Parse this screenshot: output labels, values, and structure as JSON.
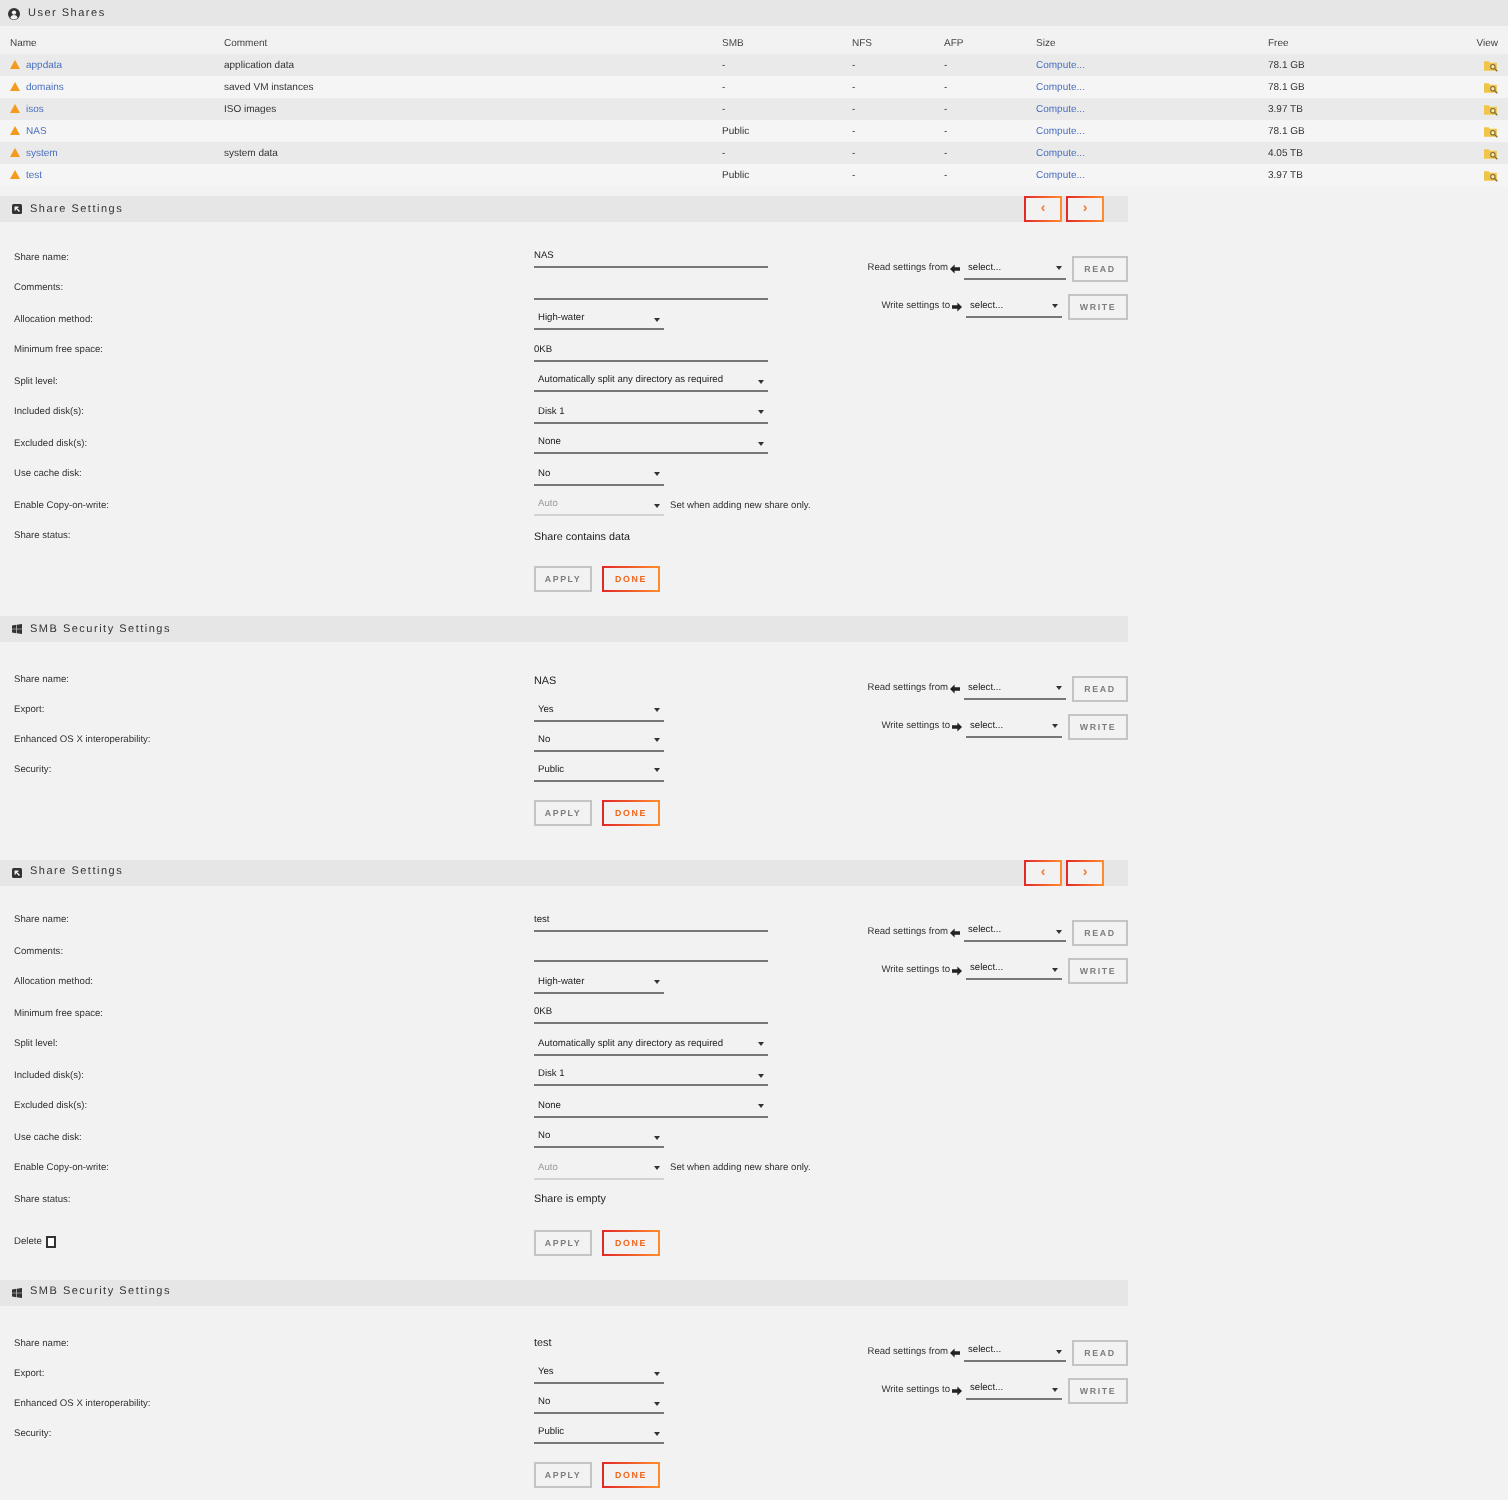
{
  "user_shares": {
    "title": "User Shares",
    "columns": [
      "Name",
      "Comment",
      "SMB",
      "NFS",
      "AFP",
      "Size",
      "Free",
      "View"
    ],
    "rows": [
      {
        "name": "appdata",
        "comment": "application data",
        "smb": "-",
        "nfs": "-",
        "afp": "-",
        "size": "Compute...",
        "free": "78.1 GB"
      },
      {
        "name": "domains",
        "comment": "saved VM instances",
        "smb": "-",
        "nfs": "-",
        "afp": "-",
        "size": "Compute...",
        "free": "78.1 GB"
      },
      {
        "name": "isos",
        "comment": "ISO images",
        "smb": "-",
        "nfs": "-",
        "afp": "-",
        "size": "Compute...",
        "free": "3.97 TB"
      },
      {
        "name": "NAS",
        "smb": "Public",
        "nfs": "-",
        "afp": "-",
        "size": "Compute...",
        "free": "78.1 GB"
      },
      {
        "name": "system",
        "comment": "system data",
        "smb": "-",
        "nfs": "-",
        "afp": "-",
        "size": "Compute...",
        "free": "4.05 TB"
      },
      {
        "name": "test",
        "smb": "Public",
        "nfs": "-",
        "afp": "-",
        "size": "Compute...",
        "free": "3.97 TB"
      }
    ]
  },
  "sections": [
    {
      "kind": "share",
      "title": "Share Settings",
      "nav_buttons": [
        "‹",
        "›"
      ],
      "fields": [
        {
          "kind": "input",
          "label": "Share name:",
          "value": "NAS",
          "disabled": false
        },
        {
          "kind": "input",
          "label": "Comments:",
          "disabled": false
        },
        {
          "kind": "select",
          "label": "Allocation method:",
          "value": "High-water",
          "disabled": false
        },
        {
          "kind": "input",
          "label": "Minimum free space:",
          "value": "0KB",
          "disabled": false
        },
        {
          "kind": "wideselect",
          "label": "Split level:",
          "value": "Automatically split any directory as required",
          "disabled": false
        },
        {
          "kind": "wideselect",
          "label": "Included disk(s):",
          "value": "Disk 1",
          "disabled": false
        },
        {
          "kind": "wideselect",
          "label": "Excluded disk(s):",
          "value": "None",
          "disabled": false
        },
        {
          "kind": "select",
          "label": "Use cache disk:",
          "value": "No",
          "disabled": false
        },
        {
          "kind": "select",
          "label": "Enable Copy-on-write:",
          "value": "Auto",
          "disabled": true,
          "note": "Set when adding new share only."
        },
        {
          "kind": "static",
          "label": "Share status:",
          "value": "Share contains data",
          "disabled": false
        }
      ],
      "read": {
        "label": "Read settings from",
        "value": "select...",
        "button": "READ",
        "disabled": true
      },
      "write": {
        "label": "Write settings to",
        "value": "select...",
        "button": "WRITE",
        "disabled": true
      },
      "buttons": [
        {
          "label": "APPLY",
          "disabled": true
        },
        {
          "label": "DONE",
          "disabled": false
        }
      ]
    },
    {
      "kind": "smb",
      "title": "SMB Security Settings",
      "fields": [
        {
          "kind": "static",
          "label": "Share name:",
          "value": "NAS",
          "disabled": false
        },
        {
          "kind": "select",
          "label": "Export:",
          "value": "Yes",
          "disabled": false
        },
        {
          "kind": "select",
          "label": "Enhanced OS X interoperability:",
          "value": "No",
          "disabled": false
        },
        {
          "kind": "select",
          "label": "Security:",
          "value": "Public",
          "disabled": false
        }
      ],
      "read": {
        "label": "Read settings from",
        "value": "select...",
        "button": "READ",
        "disabled": true
      },
      "write": {
        "label": "Write settings to",
        "value": "select...",
        "button": "WRITE",
        "disabled": true
      },
      "buttons": [
        {
          "label": "APPLY",
          "disabled": true
        },
        {
          "label": "DONE",
          "disabled": false
        }
      ]
    },
    {
      "kind": "share",
      "title": "Share Settings",
      "nav_buttons": [
        "‹",
        "›"
      ],
      "fields": [
        {
          "kind": "input",
          "label": "Share name:",
          "value": "test",
          "disabled": false
        },
        {
          "kind": "input",
          "label": "Comments:",
          "disabled": false
        },
        {
          "kind": "select",
          "label": "Allocation method:",
          "value": "High-water",
          "disabled": false
        },
        {
          "kind": "input",
          "label": "Minimum free space:",
          "value": "0KB",
          "disabled": false
        },
        {
          "kind": "wideselect",
          "label": "Split level:",
          "value": "Automatically split any directory as required",
          "disabled": false
        },
        {
          "kind": "wideselect",
          "label": "Included disk(s):",
          "value": "Disk 1",
          "disabled": false
        },
        {
          "kind": "wideselect",
          "label": "Excluded disk(s):",
          "value": "None",
          "disabled": false
        },
        {
          "kind": "select",
          "label": "Use cache disk:",
          "value": "No",
          "disabled": false
        },
        {
          "kind": "select",
          "label": "Enable Copy-on-write:",
          "value": "Auto",
          "disabled": true,
          "note": "Set when adding new share only."
        },
        {
          "kind": "static",
          "label": "Share status:",
          "value": "Share is empty",
          "disabled": false
        }
      ],
      "delete": {
        "label": "Delete",
        "checked": false
      },
      "read": {
        "label": "Read settings from",
        "value": "select...",
        "button": "READ",
        "disabled": true
      },
      "write": {
        "label": "Write settings to",
        "value": "select...",
        "button": "WRITE",
        "disabled": true
      },
      "buttons": [
        {
          "label": "APPLY",
          "disabled": true
        },
        {
          "label": "DONE",
          "disabled": false
        }
      ]
    },
    {
      "kind": "smb",
      "title": "SMB Security Settings",
      "fields": [
        {
          "kind": "static",
          "label": "Share name:",
          "value": "test",
          "disabled": false
        },
        {
          "kind": "select",
          "label": "Export:",
          "value": "Yes",
          "disabled": false
        },
        {
          "kind": "select",
          "label": "Enhanced OS X interoperability:",
          "value": "No",
          "disabled": false
        },
        {
          "kind": "select",
          "label": "Security:",
          "value": "Public",
          "disabled": false
        }
      ],
      "read": {
        "label": "Read settings from",
        "value": "select...",
        "button": "READ",
        "disabled": true
      },
      "write": {
        "label": "Write settings to",
        "value": "select...",
        "button": "WRITE",
        "disabled": true
      },
      "buttons": [
        {
          "label": "APPLY",
          "disabled": true
        },
        {
          "label": "DONE",
          "disabled": false
        }
      ]
    }
  ]
}
